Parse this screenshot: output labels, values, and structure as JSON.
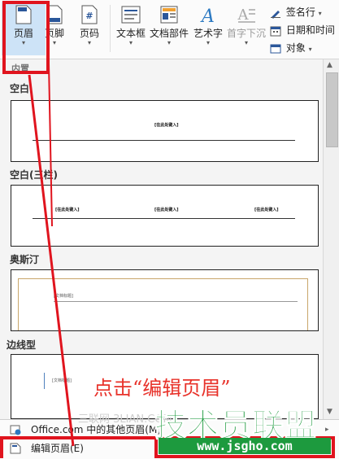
{
  "ribbon": {
    "header_button": "页眉",
    "footer_button": "页脚",
    "page_number_button": "页码",
    "page_number_glyph": "#",
    "textbox_button": "文本框",
    "doc_parts_button": "文档部件",
    "wordart_button": "艺术字",
    "dropcap_button": "首字下沉",
    "signature_line": "签名行",
    "date_time": "日期和时间",
    "object": "对象",
    "group_label": "内置",
    "accent_color": "#2b579a"
  },
  "gallery": {
    "sections": [
      {
        "title": "空白",
        "placeholders": [
          "[在此处键入]"
        ]
      },
      {
        "title": "空白(三栏)",
        "placeholders": [
          "[在此处键入]",
          "[在此处键入]",
          "[在此处键入]"
        ]
      },
      {
        "title": "奥斯汀",
        "placeholders": [
          "[文档标题]"
        ]
      },
      {
        "title": "边线型",
        "placeholders": [
          "[文档标题]"
        ]
      }
    ]
  },
  "menu": {
    "more_headers": "Office.com 中的其他页眉(M)",
    "edit_header": "编辑页眉(E)"
  },
  "annotation": {
    "text": "点击“编辑页眉”",
    "color": "#e0141e"
  },
  "watermark": {
    "brand": "技术员联盟",
    "url": "www.jsgho.com",
    "faint": "三联网 3LIAN.COM",
    "color": "#1d9a3e"
  }
}
